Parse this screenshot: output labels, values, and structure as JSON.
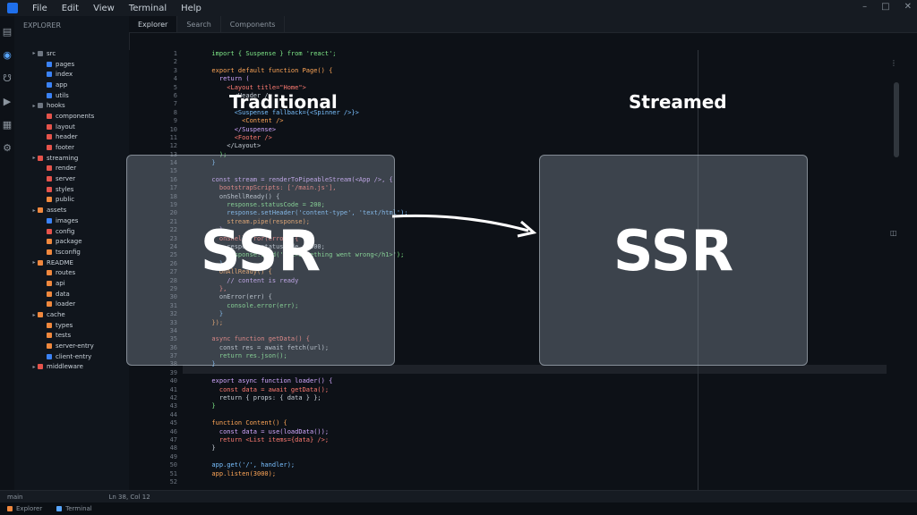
{
  "menubar": {
    "items": [
      "File",
      "Edit",
      "View",
      "Terminal",
      "Help"
    ]
  },
  "tabs": [
    "Explorer",
    "Search",
    "Components"
  ],
  "sidebar": {
    "title": "EXPLORER",
    "files": [
      {
        "label": "src",
        "color": "#6e7681"
      },
      {
        "label": "pages",
        "color": "#3b82f6"
      },
      {
        "label": "index",
        "color": "#3b82f6"
      },
      {
        "label": "app",
        "color": "#3b82f6"
      },
      {
        "label": "utils",
        "color": "#3b82f6"
      },
      {
        "label": "hooks",
        "color": "#6e7681"
      },
      {
        "label": "components",
        "color": "#e5534b"
      },
      {
        "label": "layout",
        "color": "#e5534b"
      },
      {
        "label": "header",
        "color": "#e5534b"
      },
      {
        "label": "footer",
        "color": "#e5534b"
      },
      {
        "label": "streaming",
        "color": "#e5534b"
      },
      {
        "label": "render",
        "color": "#e5534b"
      },
      {
        "label": "server",
        "color": "#e5534b"
      },
      {
        "label": "styles",
        "color": "#e5534b"
      },
      {
        "label": "public",
        "color": "#f0883e"
      },
      {
        "label": "assets",
        "color": "#f0883e"
      },
      {
        "label": "images",
        "color": "#3b82f6"
      },
      {
        "label": "config",
        "color": "#e5534b"
      },
      {
        "label": "package",
        "color": "#f0883e"
      },
      {
        "label": "tsconfig",
        "color": "#f0883e"
      },
      {
        "label": "README",
        "color": "#f0883e"
      },
      {
        "label": "routes",
        "color": "#f0883e"
      },
      {
        "label": "api",
        "color": "#f0883e"
      },
      {
        "label": "data",
        "color": "#f0883e"
      },
      {
        "label": "loader",
        "color": "#f0883e"
      },
      {
        "label": "cache",
        "color": "#f0883e"
      },
      {
        "label": "types",
        "color": "#f0883e"
      },
      {
        "label": "tests",
        "color": "#f0883e"
      },
      {
        "label": "server-entry",
        "color": "#f0883e"
      },
      {
        "label": "client-entry",
        "color": "#3b82f6"
      },
      {
        "label": "middleware",
        "color": "#e5534b"
      }
    ]
  },
  "editor": {
    "line_numbers": [
      "1",
      "2",
      "3",
      "4",
      "5",
      "6",
      "7",
      "8",
      "9",
      "10",
      "11",
      "12",
      "13",
      "14",
      "15",
      "16",
      "17",
      "18",
      "19",
      "20",
      "21",
      "22",
      "23",
      "24",
      "25",
      "26",
      "27",
      "28",
      "29",
      "30",
      "31",
      "32",
      "33",
      "34",
      "35",
      "36",
      "37",
      "38",
      "39",
      "40",
      "41",
      "42",
      "43",
      "44",
      "45",
      "46",
      "47",
      "48",
      "49",
      "50",
      "51",
      "52"
    ],
    "code_lines": [
      "  import { Suspense } from 'react';",
      "",
      "  export default function Page() {",
      "    return (",
      "      <Layout title=\"Home\">",
      "        <Header />",
      "",
      "        <Suspense fallback={<Spinner />}>",
      "          <Content />",
      "        </Suspense>",
      "        <Footer />",
      "      </Layout>",
      "    );",
      "  }",
      "",
      "  const stream = renderToPipeableStream(<App />, {",
      "    bootstrapScripts: ['/main.js'],",
      "    onShellReady() {",
      "      response.statusCode = 200;",
      "      response.setHeader('content-type', 'text/html');",
      "      stream.pipe(response);",
      "    },",
      "    onShellError(error) {",
      "      response.statusCode = 500;",
      "      response.send('<h1>Something went wrong</h1>');",
      "    },",
      "    onAllReady() {",
      "      // content is ready",
      "    },",
      "    onError(err) {",
      "      console.error(err);",
      "    }",
      "  });",
      "",
      "  async function getData() {",
      "    const res = await fetch(url);",
      "    return res.json();",
      "  }",
      "",
      "  export async function loader() {",
      "    const data = await getData();",
      "    return { props: { data } };",
      "  }",
      "",
      "  function Content() {",
      "    const data = use(loadData());",
      "    return <List items={data} />;",
      "  }",
      "",
      "  app.get('/', handler);",
      "  app.listen(3000);",
      ""
    ]
  },
  "overlay": {
    "left_heading": "Traditional",
    "right_heading": "Streamed",
    "left_label": "SSR",
    "right_label": "SSR"
  },
  "statusbar": {
    "left": "main",
    "mid": "Ln 38, Col 12"
  },
  "taskbar": {
    "items": [
      "Explorer",
      "Terminal"
    ]
  }
}
